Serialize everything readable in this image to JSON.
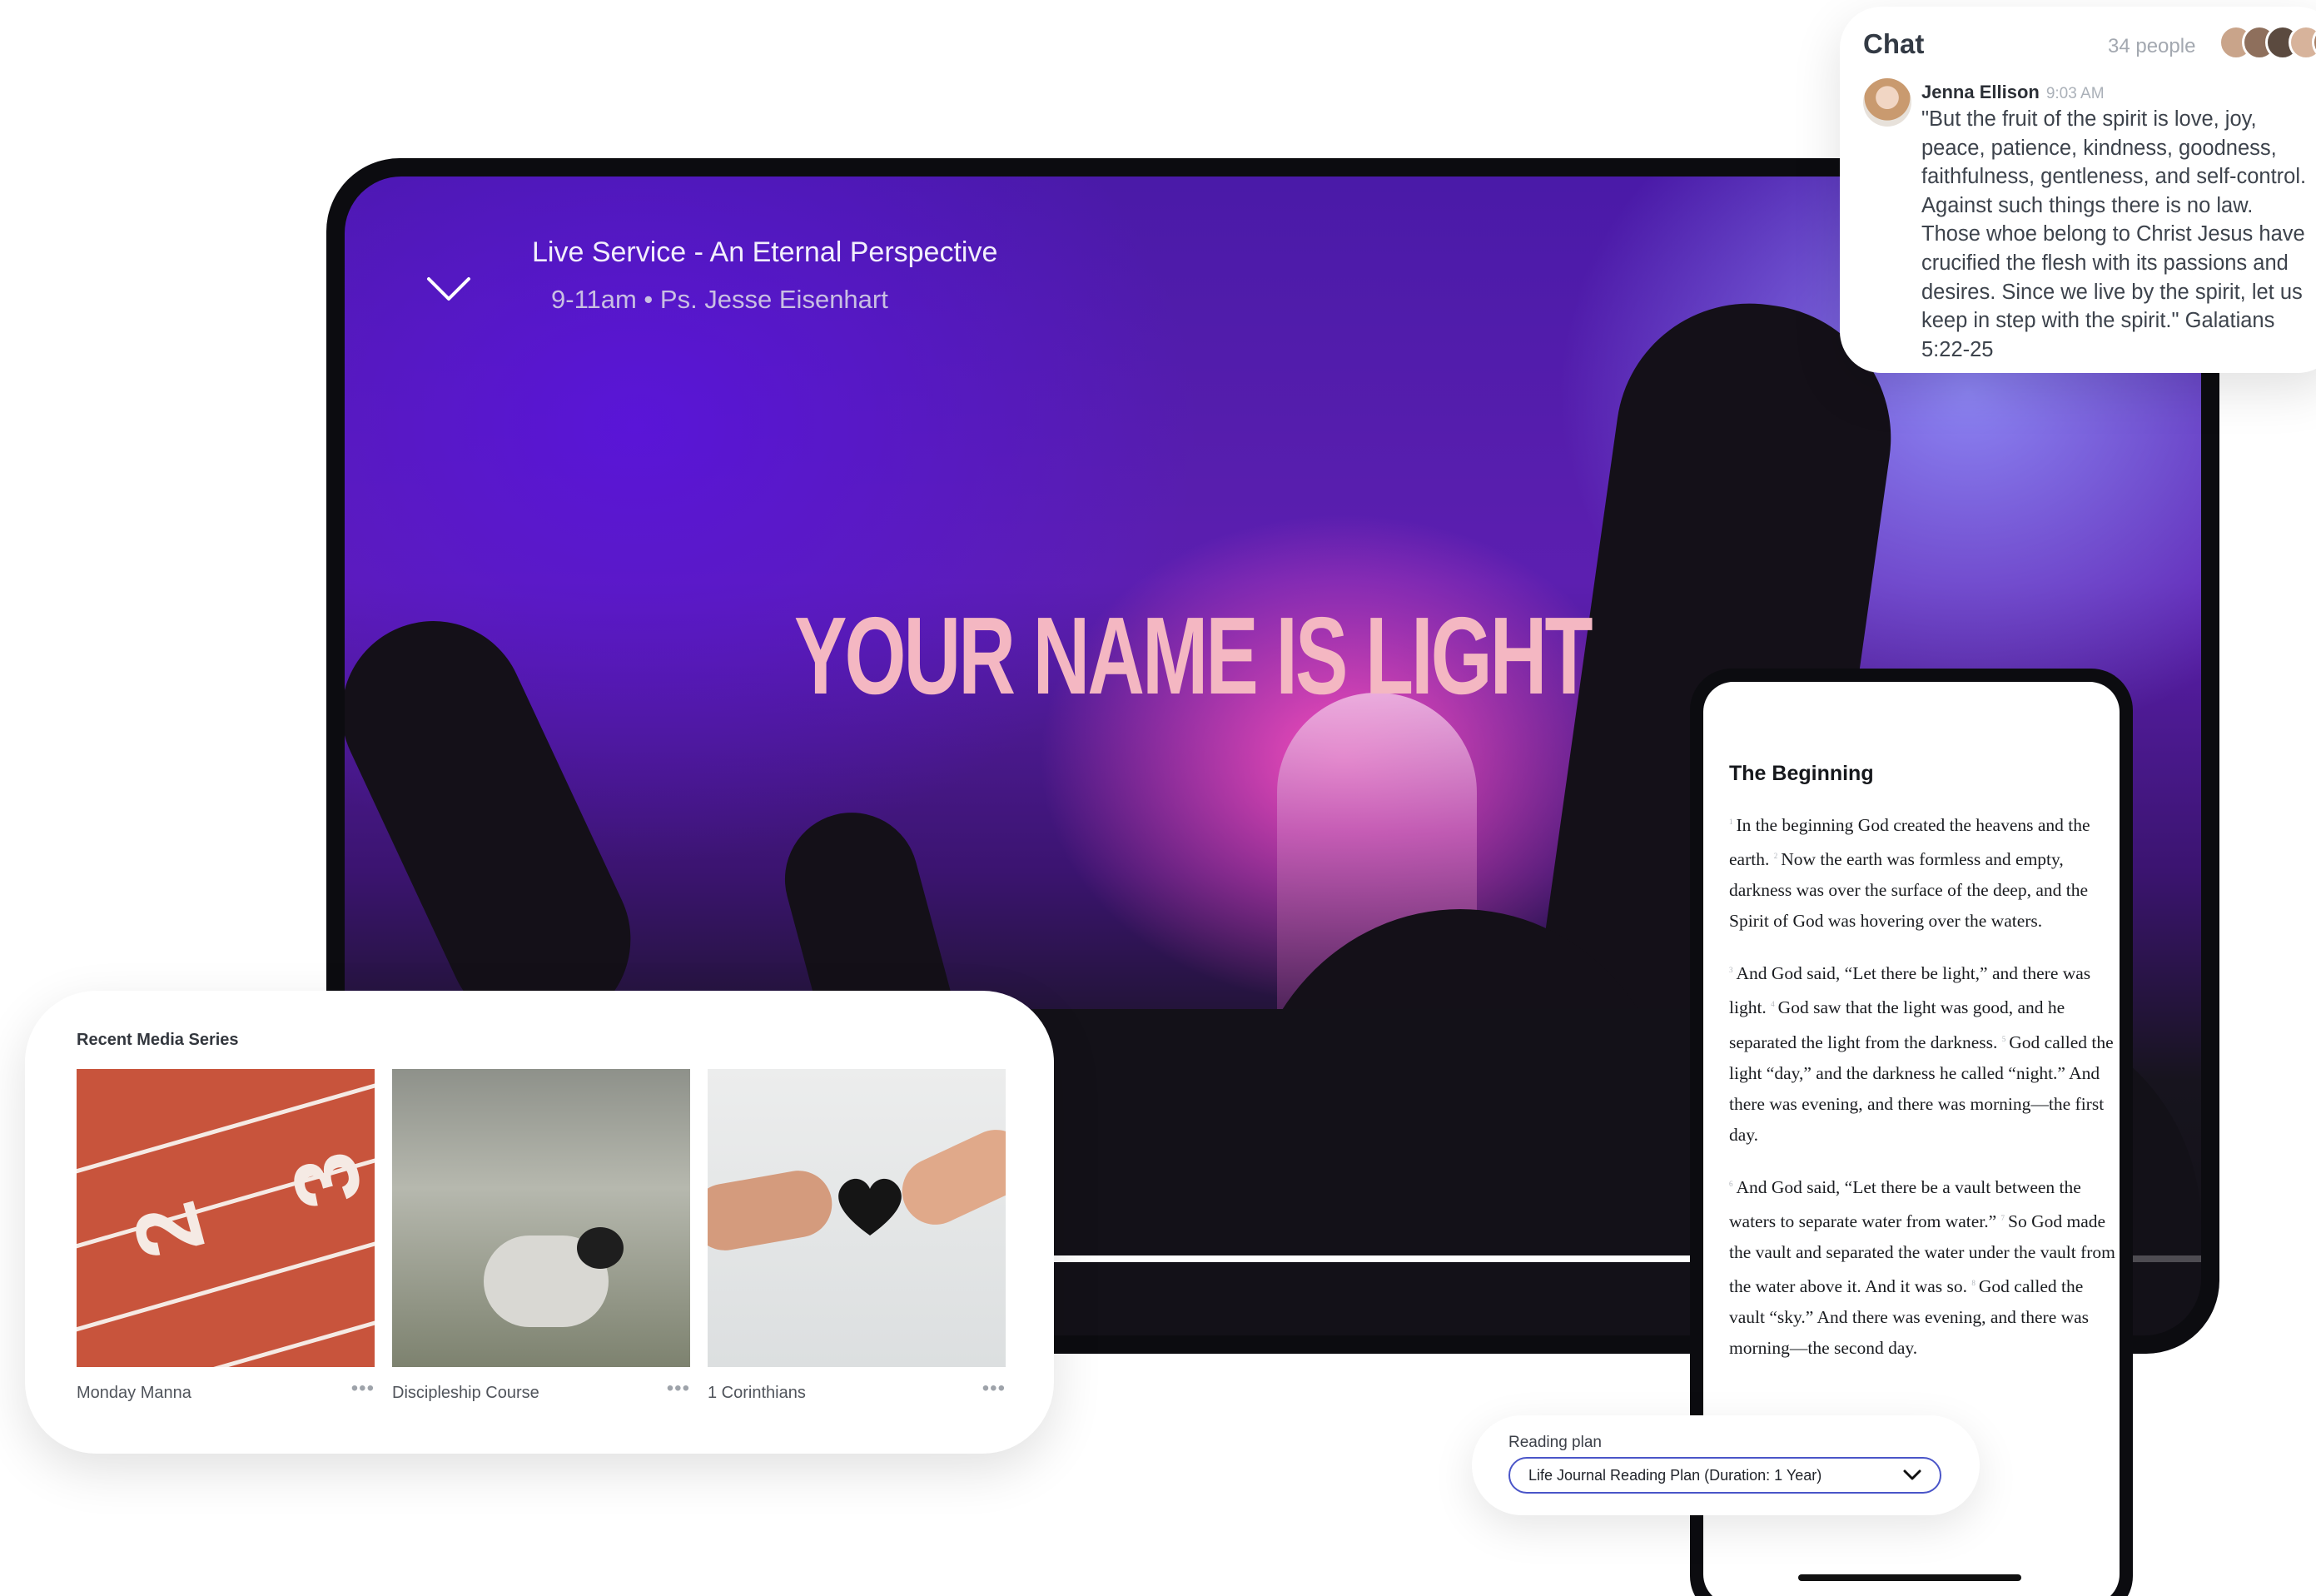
{
  "video": {
    "title": "Live Service - An Eternal Perspective",
    "subtitle": "9-11am • Ps. Jesse Eisenhart",
    "lyric": "YOUR NAME IS LIGHT",
    "progress_fraction": 0.82
  },
  "chat": {
    "title": "Chat",
    "people_count": "34 people",
    "avatar_colors": [
      "#c9a48a",
      "#8e6f5c",
      "#5b4a3f",
      "#d7b39b",
      "#a67c62"
    ],
    "message": {
      "author": "Jenna Ellison",
      "time": "9:03 AM",
      "text": "\"But the fruit of the spirit is love, joy, peace, patience, kindness, goodness, faithfulness, gentleness, and self-control. Against such things there is no law. Those whoe belong to Christ Jesus have crucified the flesh with its passions and desires. Since we live by the spirit, let us keep in step with the spirit.\" Galatians 5:22-25"
    }
  },
  "bible": {
    "chapter_title": "The Beginning",
    "paragraphs": [
      [
        {
          "verse": "1",
          "text": "In the beginning God created the heavens and the earth. "
        },
        {
          "verse": "2",
          "text": "Now the earth was formless and empty, darkness was over the surface of the deep, and the Spirit of God was hovering over the waters."
        }
      ],
      [
        {
          "verse": "3",
          "text": "And God said, “Let there be light,” and there was light. "
        },
        {
          "verse": "4",
          "text": "God saw that the light was good, and he separated the light from the darkness. "
        },
        {
          "verse": "5",
          "text": "God called the light “day,” and the darkness he called “night.” And there was evening, and there was morning—the first day."
        }
      ],
      [
        {
          "verse": "6",
          "text": "And God said, “Let there be a vault between the waters to separate water from water.” "
        },
        {
          "verse": "7",
          "text": "So God made the vault and separated the water under the vault from the water above it. And it was so. "
        },
        {
          "verse": "8",
          "text": "God called the vault “sky.” And there was evening, and there was morning—the second day."
        }
      ]
    ]
  },
  "reading_plan": {
    "label": "Reading plan",
    "selected": "Life Journal Reading Plan (Duration: 1 Year)"
  },
  "media": {
    "heading": "Recent Media Series",
    "items": [
      {
        "title": "Monday Manna",
        "more": "•••"
      },
      {
        "title": "Discipleship Course",
        "more": "•••"
      },
      {
        "title": "1 Corinthians",
        "more": "•••"
      }
    ]
  },
  "icons": {
    "collapse": "chevron-down-icon",
    "plan_dropdown": "chevron-down-icon"
  },
  "colors": {
    "accent": "#4a55c8",
    "video_purple": "#5c1fb0",
    "video_pink": "#ff50be",
    "lyric": "#f4b7c2"
  }
}
